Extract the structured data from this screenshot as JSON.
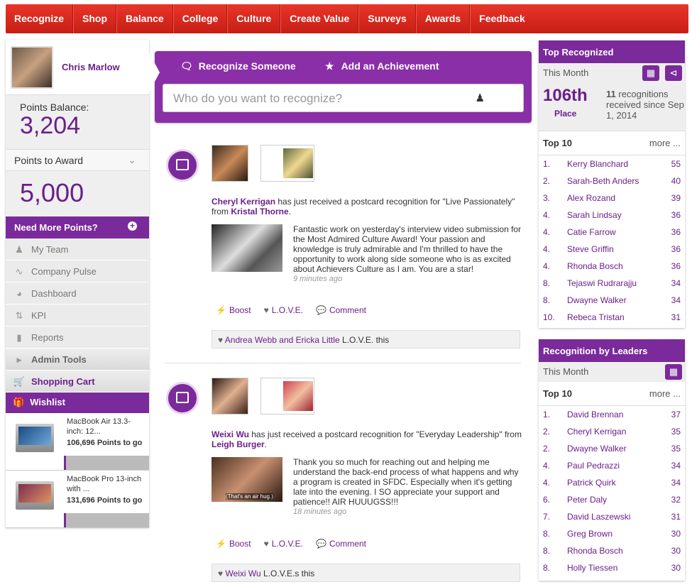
{
  "nav": [
    "Recognize",
    "Shop",
    "Balance",
    "College",
    "Culture",
    "Create Value",
    "Surveys",
    "Awards",
    "Feedback"
  ],
  "user": {
    "name": "Chris Marlow"
  },
  "balance": {
    "label": "Points Balance:",
    "value": "3,204"
  },
  "award": {
    "label": "Points to Award",
    "value": "5,000"
  },
  "need_points": "Need More Points?",
  "menu": [
    "My Team",
    "Company Pulse",
    "Dashboard",
    "KPI",
    "Reports",
    "Admin Tools",
    "Shopping Cart"
  ],
  "wishlist": {
    "title": "Wishlist",
    "items": [
      {
        "name": "MacBook Air 13.3-inch: 12...",
        "points": "106,696 Points to go"
      },
      {
        "name": "MacBook Pro 13-inch with ...",
        "points": "131,696 Points to go"
      }
    ]
  },
  "recognize": {
    "tab1": "Recognize Someone",
    "tab2": "Add an Achievement",
    "placeholder": "Who do you want to recognize?"
  },
  "posts": [
    {
      "recipient": "Cheryl Kerrigan",
      "mid": " has just received a postcard recognition for \"Live Passionately\" from ",
      "sender": "Kristal Thorne",
      "message": "Fantastic work on yesterday's interview video submission for the Most Admired Culture Award! Your passion and knowledge is truly admirable and I'm thrilled to have the opportunity to work along side someone who is as excited about Achievers Culture as I am. You are a star!",
      "time": "9 minutes ago",
      "loves": "Andrea Webb and Ericka Little",
      "loves_suffix": " L.O.V.E. this"
    },
    {
      "recipient": "Weixi Wu",
      "mid": " has just received a postcard recognition for \"Everyday Leadership\" from ",
      "sender": "Leigh Burger",
      "message": "Thank you so much for reaching out and helping me understand the back-end process of what happens and why a program is created in SFDC. Especially when it's getting late into the evening. I SO appreciate your support and patience!! AIR HUUUGSS!!!",
      "time": "18 minutes ago",
      "img_caption": "(That's an air hug.)",
      "loves": "Weixi Wu",
      "loves_suffix": " L.O.V.E.s this"
    }
  ],
  "actions": {
    "boost": "Boost",
    "love": "L.O.V.E.",
    "comment": "Comment"
  },
  "top": {
    "title": "Top Recognized",
    "period": "This Month",
    "place": "106th",
    "place_label": "Place",
    "count": "11",
    "since": " recognitions received since Sep 1, 2014",
    "top10": "Top 10",
    "more": "more ...",
    "list": [
      [
        "1.",
        "Kerry Blanchard",
        "55"
      ],
      [
        "2.",
        "Sarah-Beth Anders",
        "40"
      ],
      [
        "3.",
        "Alex Rozand",
        "39"
      ],
      [
        "4.",
        "Sarah Lindsay",
        "36"
      ],
      [
        "4.",
        "Catie Farrow",
        "36"
      ],
      [
        "4.",
        "Steve Griffin",
        "36"
      ],
      [
        "4.",
        "Rhonda Bosch",
        "36"
      ],
      [
        "8.",
        "Tejaswi Rudrarajju",
        "34"
      ],
      [
        "8.",
        "Dwayne Walker",
        "34"
      ],
      [
        "10.",
        "Rebeca Tristan",
        "31"
      ]
    ]
  },
  "leaders": {
    "title": "Recognition by Leaders",
    "period": "This Month",
    "top10": "Top 10",
    "more": "more ...",
    "list": [
      [
        "1.",
        "David Brennan",
        "37"
      ],
      [
        "2.",
        "Cheryl Kerrigan",
        "35"
      ],
      [
        "2.",
        "Dwayne Walker",
        "35"
      ],
      [
        "4.",
        "Paul Pedrazzi",
        "34"
      ],
      [
        "4.",
        "Patrick Quirk",
        "34"
      ],
      [
        "6.",
        "Peter Daly",
        "32"
      ],
      [
        "7.",
        "David Laszewski",
        "31"
      ],
      [
        "8.",
        "Greg Brown",
        "30"
      ],
      [
        "8.",
        "Rhonda Bosch",
        "30"
      ],
      [
        "8.",
        "Holly Tiessen",
        "30"
      ]
    ]
  }
}
